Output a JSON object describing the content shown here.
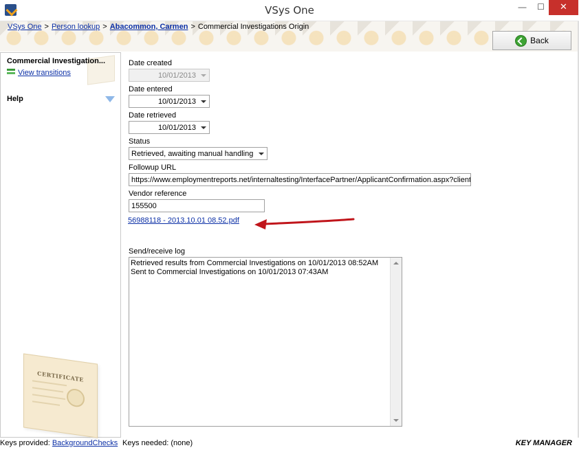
{
  "window": {
    "title": "VSys One",
    "minimize": "—",
    "maximize": "☐",
    "close": "✕"
  },
  "breadcrumb": {
    "item1": "VSys One",
    "item2": "Person lookup",
    "item3": "Abacommon, Carmen",
    "current": "Commercial Investigations Origin",
    "sep": ">"
  },
  "toolbar": {
    "back_label": "Back"
  },
  "sidebar": {
    "title": "Commercial Investigation...",
    "transitions_link": "View transitions",
    "help_label": "Help",
    "certificate_text": "CERTIFICATE"
  },
  "form": {
    "date_created_label": "Date created",
    "date_created_value": "10/01/2013",
    "date_entered_label": "Date entered",
    "date_entered_value": "10/01/2013",
    "date_retrieved_label": "Date retrieved",
    "date_retrieved_value": "10/01/2013",
    "status_label": "Status",
    "status_value": "Retrieved, awaiting manual handling",
    "followup_label": "Followup URL",
    "followup_value": "https://www.employmentreports.net/internaltesting/InterfacePartner/ApplicantConfirmation.aspx?client",
    "vendor_label": "Vendor reference",
    "vendor_value": "155500",
    "pdf_link": "56988118 - 2013.10.01 08.52.pdf",
    "log_label": "Send/receive log",
    "log_lines": [
      "Retrieved results from Commercial Investigations on 10/01/2013 08:52AM",
      "Sent to Commercial Investigations on 10/01/2013 07:43AM"
    ]
  },
  "statusbar": {
    "keys_provided_label": "Keys provided:",
    "keys_provided_link": "BackgroundChecks",
    "keys_needed": "Keys needed: (none)",
    "key_manager": "KEY MANAGER"
  },
  "colors": {
    "link": "#0b2fa6",
    "close": "#c7302b",
    "arrow": "#c0151b",
    "back_icon": "#3da334"
  }
}
